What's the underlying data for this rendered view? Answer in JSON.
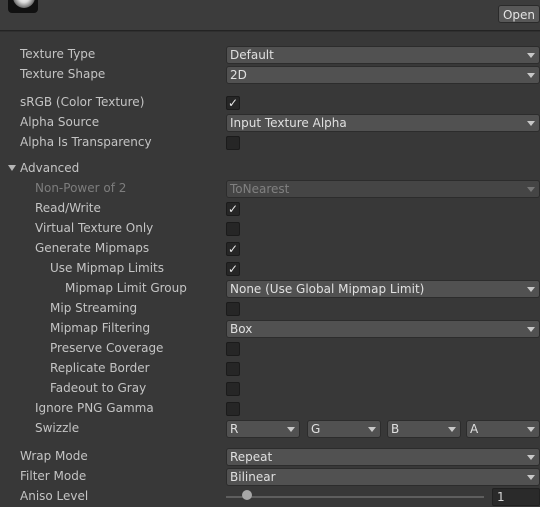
{
  "header": {
    "open_label": "Open"
  },
  "texture_type": {
    "label": "Texture Type",
    "value": "Default"
  },
  "texture_shape": {
    "label": "Texture Shape",
    "value": "2D"
  },
  "srgb": {
    "label": "sRGB (Color Texture)",
    "checked": true
  },
  "alpha_source": {
    "label": "Alpha Source",
    "value": "Input Texture Alpha"
  },
  "alpha_is_transparency": {
    "label": "Alpha Is Transparency",
    "checked": false
  },
  "advanced": {
    "label": "Advanced",
    "non_power_of_2": {
      "label": "Non-Power of 2",
      "value": "ToNearest",
      "disabled": true
    },
    "read_write": {
      "label": "Read/Write",
      "checked": true
    },
    "virtual_texture_only": {
      "label": "Virtual Texture Only",
      "checked": false
    },
    "generate_mipmaps": {
      "label": "Generate Mipmaps",
      "checked": true
    },
    "use_mipmap_limits": {
      "label": "Use Mipmap Limits",
      "checked": true
    },
    "mipmap_limit_group": {
      "label": "Mipmap Limit Group",
      "value": "None (Use Global Mipmap Limit)"
    },
    "mip_streaming": {
      "label": "Mip Streaming",
      "checked": false
    },
    "mipmap_filtering": {
      "label": "Mipmap Filtering",
      "value": "Box"
    },
    "preserve_coverage": {
      "label": "Preserve Coverage",
      "checked": false
    },
    "replicate_border": {
      "label": "Replicate Border",
      "checked": false
    },
    "fadeout_to_gray": {
      "label": "Fadeout to Gray",
      "checked": false
    },
    "ignore_png_gamma": {
      "label": "Ignore PNG Gamma",
      "checked": false
    },
    "swizzle": {
      "label": "Swizzle",
      "r": "R",
      "g": "G",
      "b": "B",
      "a": "A"
    }
  },
  "wrap_mode": {
    "label": "Wrap Mode",
    "value": "Repeat"
  },
  "filter_mode": {
    "label": "Filter Mode",
    "value": "Bilinear"
  },
  "aniso_level": {
    "label": "Aniso Level",
    "value": "1",
    "slider_fraction": 0.06
  },
  "check_glyph": "✓",
  "colors": {
    "background": "#383838",
    "field": "#515151",
    "checkbox": "#262626",
    "text": "#c4c4c4"
  }
}
